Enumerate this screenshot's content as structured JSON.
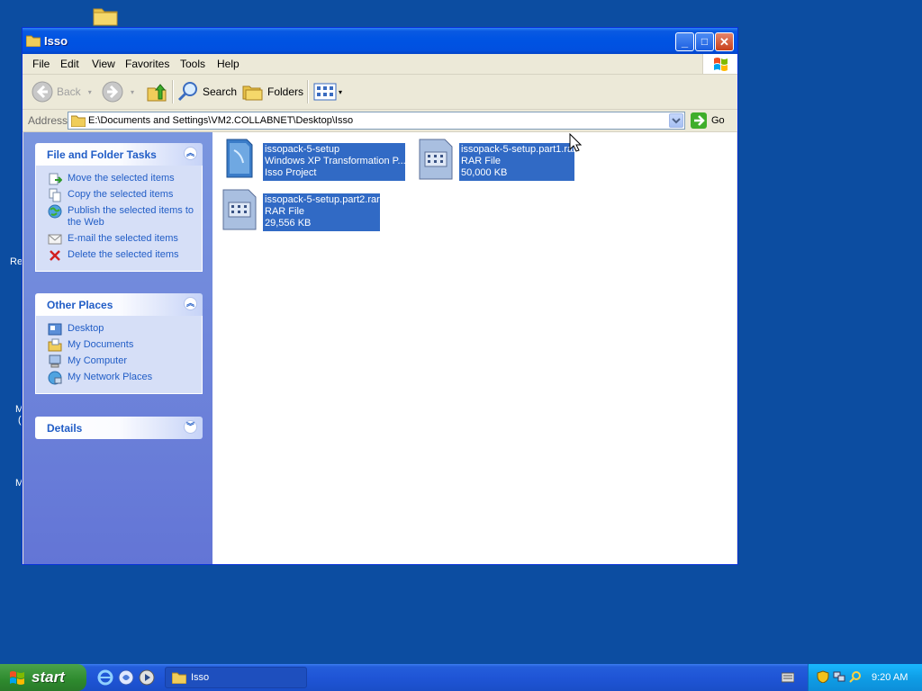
{
  "desktop": {
    "fragments": [
      "Re",
      "M",
      "(",
      "M"
    ]
  },
  "window": {
    "title": "Isso",
    "controls": {
      "minimize": "_",
      "maximize": "□",
      "close": "✕"
    }
  },
  "menu": [
    "File",
    "Edit",
    "View",
    "Favorites",
    "Tools",
    "Help"
  ],
  "toolbar": {
    "back": "Back",
    "search": "Search",
    "folders": "Folders"
  },
  "address": {
    "label": "Address",
    "path": "E:\\Documents and Settings\\VM2.COLLABNET\\Desktop\\Isso",
    "go": "Go"
  },
  "file_tasks": {
    "title": "File and Folder Tasks",
    "items": [
      {
        "label": "Move the selected items",
        "icon": "move-icon"
      },
      {
        "label": "Copy the selected items",
        "icon": "copy-icon"
      },
      {
        "label": "Publish the selected items to the Web",
        "icon": "publish-web-icon"
      },
      {
        "label": "E-mail the selected items",
        "icon": "email-icon"
      },
      {
        "label": "Delete the selected items",
        "icon": "delete-icon"
      }
    ]
  },
  "other_places": {
    "title": "Other Places",
    "items": [
      {
        "label": "Desktop",
        "icon": "desktop-icon"
      },
      {
        "label": "My Documents",
        "icon": "my-documents-icon"
      },
      {
        "label": "My Computer",
        "icon": "my-computer-icon"
      },
      {
        "label": "My Network Places",
        "icon": "network-places-icon"
      }
    ]
  },
  "details": {
    "title": "Details"
  },
  "files": [
    {
      "name": "issopack-5-setup",
      "type": "Windows XP Transformation P...",
      "size": "Isso Project",
      "icon": "project-icon"
    },
    {
      "name": "issopack-5-setup.part1.rar",
      "type": "RAR File",
      "size": "50,000 KB",
      "icon": "rar-icon"
    },
    {
      "name": "issopack-5-setup.part2.rar",
      "type": "RAR File",
      "size": "29,556 KB",
      "icon": "rar-icon"
    }
  ],
  "taskbar": {
    "start": "start",
    "task": "Isso",
    "clock": "9:20 AM"
  },
  "colors": {
    "desktop": "#0c4da1",
    "selection": "#316ac5",
    "task_link": "#215dc6"
  }
}
